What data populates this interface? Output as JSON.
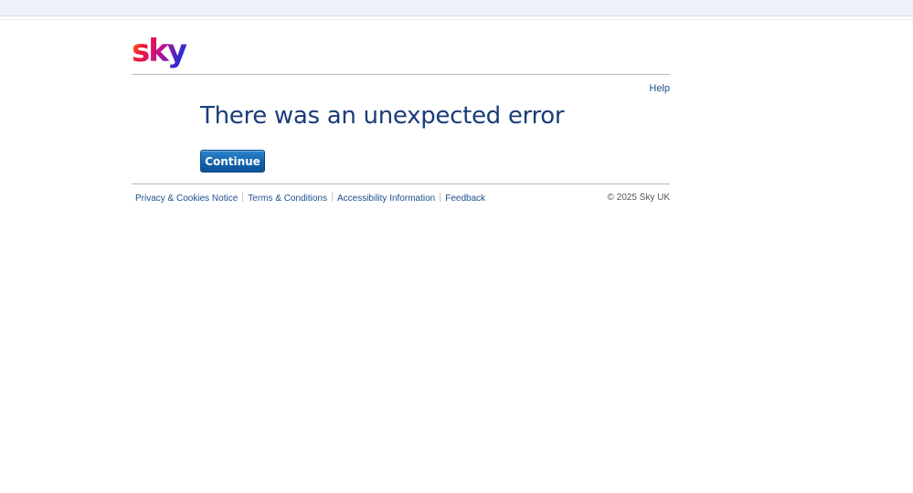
{
  "brand": {
    "logo_text": "sky"
  },
  "header": {
    "help_label": "Help"
  },
  "main": {
    "title": "There was an unexpected error",
    "continue_label": "Continue"
  },
  "footer": {
    "links": [
      {
        "label": "Privacy & Cookies Notice"
      },
      {
        "label": "Terms & Conditions"
      },
      {
        "label": "Accessibility Information"
      },
      {
        "label": "Feedback"
      }
    ],
    "copyright": "© 2025 Sky UK"
  },
  "colors": {
    "title": "#1a3c7a",
    "link": "#1d4f8c",
    "button": "#1263ad"
  }
}
